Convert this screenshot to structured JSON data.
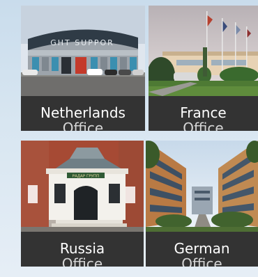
{
  "offices": [
    {
      "name": "Netherlands",
      "sub": "Office",
      "photo_sign": "GHT SUPPOR"
    },
    {
      "name": "France",
      "sub": "Office"
    },
    {
      "name": "Russia",
      "sub": "Office",
      "photo_sign": "РАДАР ГРУПП"
    },
    {
      "name": "German",
      "sub": "Office"
    }
  ]
}
